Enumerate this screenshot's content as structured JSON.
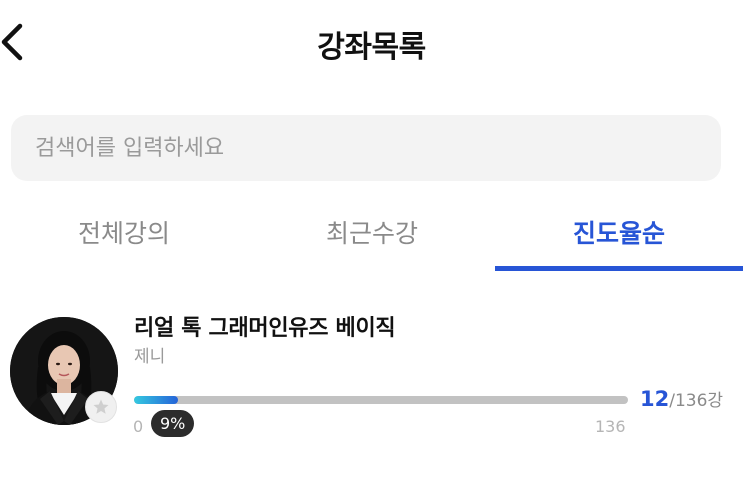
{
  "header": {
    "title": "강좌목록"
  },
  "search": {
    "placeholder": "검색어를 입력하세요",
    "value": ""
  },
  "tabs": [
    {
      "label": "전체강의",
      "active": false
    },
    {
      "label": "최근수강",
      "active": false
    },
    {
      "label": "진도율순",
      "active": true
    }
  ],
  "colors": {
    "accent": "#2755d6",
    "progress_start": "#35c9e0",
    "progress_end": "#2563d8"
  },
  "courses": [
    {
      "title": "리얼 톡 그래머인유즈 베이직",
      "teacher": "제니",
      "completed": "12",
      "total_label": "/136강",
      "range_min": "0",
      "range_max": "136",
      "percent_label": "9%",
      "progress_fraction": 0.09
    }
  ],
  "icons": {
    "back": "chevron-left-icon",
    "favorite": "star-icon"
  }
}
